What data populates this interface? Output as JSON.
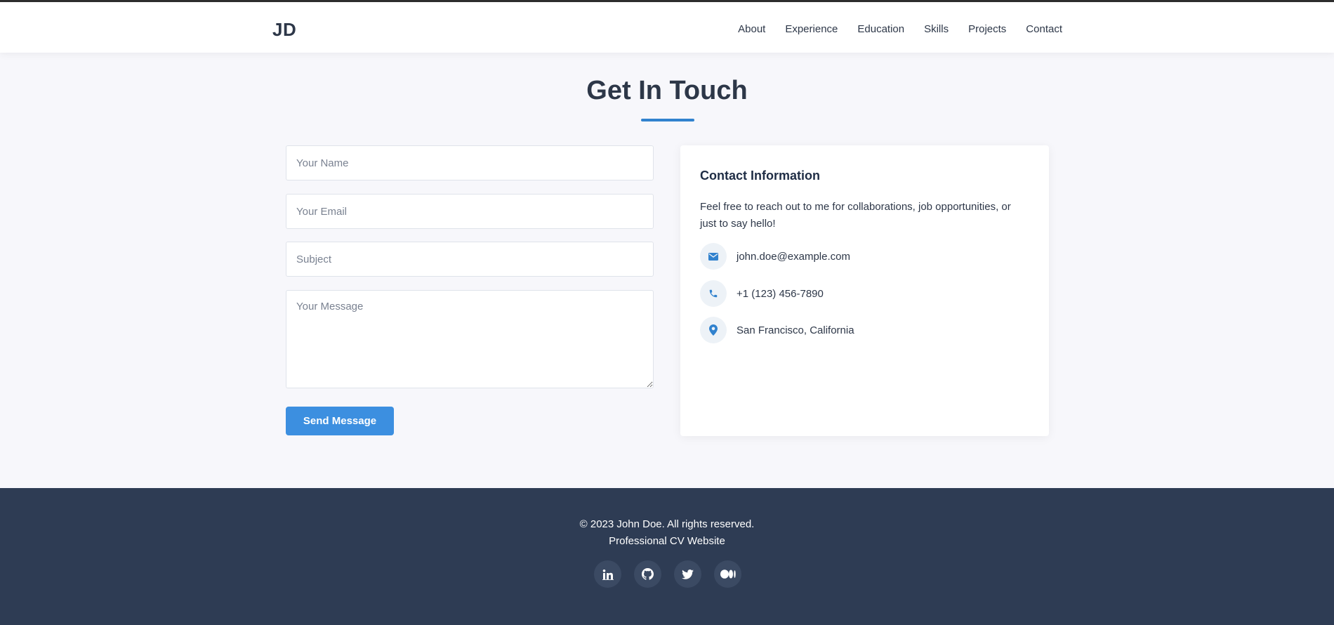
{
  "header": {
    "logo": "JD",
    "nav": [
      {
        "label": "About"
      },
      {
        "label": "Experience"
      },
      {
        "label": "Education"
      },
      {
        "label": "Skills"
      },
      {
        "label": "Projects"
      },
      {
        "label": "Contact"
      }
    ]
  },
  "section": {
    "title": "Get In Touch"
  },
  "form": {
    "name_placeholder": "Your Name",
    "email_placeholder": "Your Email",
    "subject_placeholder": "Subject",
    "message_placeholder": "Your Message",
    "submit_label": "Send Message"
  },
  "contact_info": {
    "title": "Contact Information",
    "description": "Feel free to reach out to me for collaborations, job opportunities, or just to say hello!",
    "items": [
      {
        "icon": "envelope-icon",
        "text": "john.doe@example.com"
      },
      {
        "icon": "phone-icon",
        "text": "+1 (123) 456-7890"
      },
      {
        "icon": "location-pin-icon",
        "text": "San Francisco, California"
      }
    ]
  },
  "footer": {
    "copyright": "© 2023 John Doe. All rights reserved.",
    "tagline": "Professional CV Website",
    "social": [
      {
        "icon": "linkedin-icon"
      },
      {
        "icon": "github-icon"
      },
      {
        "icon": "twitter-icon"
      },
      {
        "icon": "medium-icon"
      }
    ]
  },
  "colors": {
    "accent": "#3182ce",
    "button": "#3c8fe0",
    "footer_bg": "#2e3c54",
    "page_bg": "#f7f7fb"
  }
}
